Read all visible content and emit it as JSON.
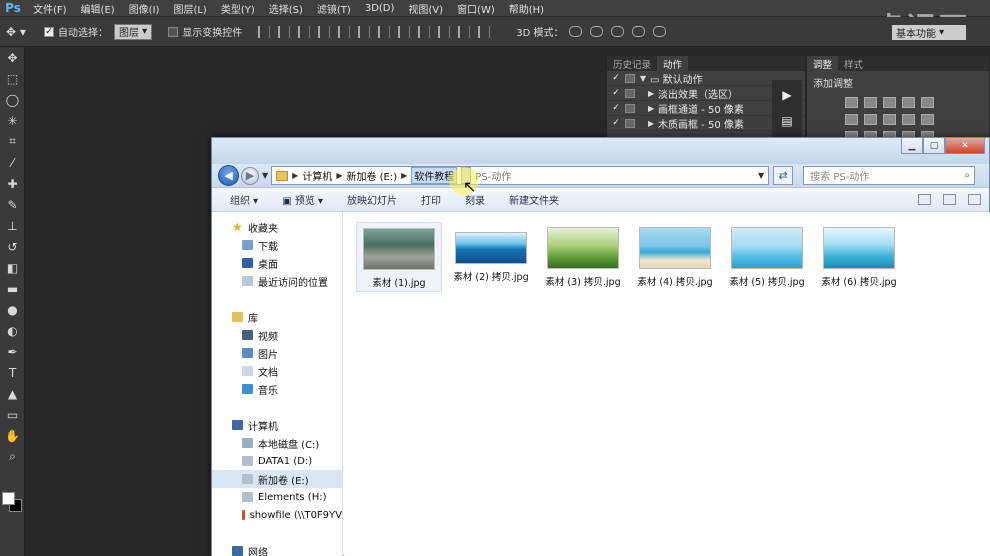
{
  "photoshop": {
    "logo": "Ps",
    "menu": [
      "文件(F)",
      "编辑(E)",
      "图像(I)",
      "图层(L)",
      "类型(Y)",
      "选择(S)",
      "滤镜(T)",
      "3D(D)",
      "视图(V)",
      "窗口(W)",
      "帮助(H)"
    ],
    "options": {
      "auto_select_label": "自动选择：",
      "auto_select_value": "图层",
      "show_transform_label": "显示变换控件",
      "mode_label": "3D 模式：",
      "workspace": "基本功能"
    },
    "watermark": "虎课网",
    "panels": {
      "history_tab": "历史记录",
      "actions_tab": "动作",
      "actions": [
        {
          "label": "默认动作",
          "folder": true
        },
        {
          "label": "淡出效果（选区）"
        },
        {
          "label": "画框通道 - 50 像素"
        },
        {
          "label": "木质画框 - 50 像素"
        }
      ],
      "adjust_tab1": "调整",
      "adjust_tab2": "样式",
      "adjust_title": "添加调整"
    }
  },
  "explorer": {
    "address": {
      "crumbs": [
        "计算机",
        "新加卷 (E:)",
        "软件教程"
      ],
      "typed": "PS-动作"
    },
    "search_placeholder": "搜索 PS-动作",
    "commands": [
      "组织 ▾",
      "预览 ▾",
      "放映幻灯片",
      "打印",
      "刻录",
      "新建文件夹"
    ],
    "nav": {
      "favorites": "收藏夹",
      "favorites_items": [
        "下载",
        "桌面",
        "最近访问的位置"
      ],
      "libraries": "库",
      "libraries_items": [
        "视频",
        "图片",
        "文档",
        "音乐"
      ],
      "computer": "计算机",
      "computer_items": [
        "本地磁盘 (C:)",
        "DATA1 (D:)",
        "新加卷 (E:)",
        "Elements (H:)",
        "showfile (\\\\T0F9YV"
      ],
      "network": "网络"
    },
    "files": [
      "素材 (1).jpg",
      "素材 (2) 拷贝.jpg",
      "素材 (3) 拷贝.jpg",
      "素材 (4) 拷贝.jpg",
      "素材 (5) 拷贝.jpg",
      "素材 (6) 拷贝.jpg"
    ]
  }
}
